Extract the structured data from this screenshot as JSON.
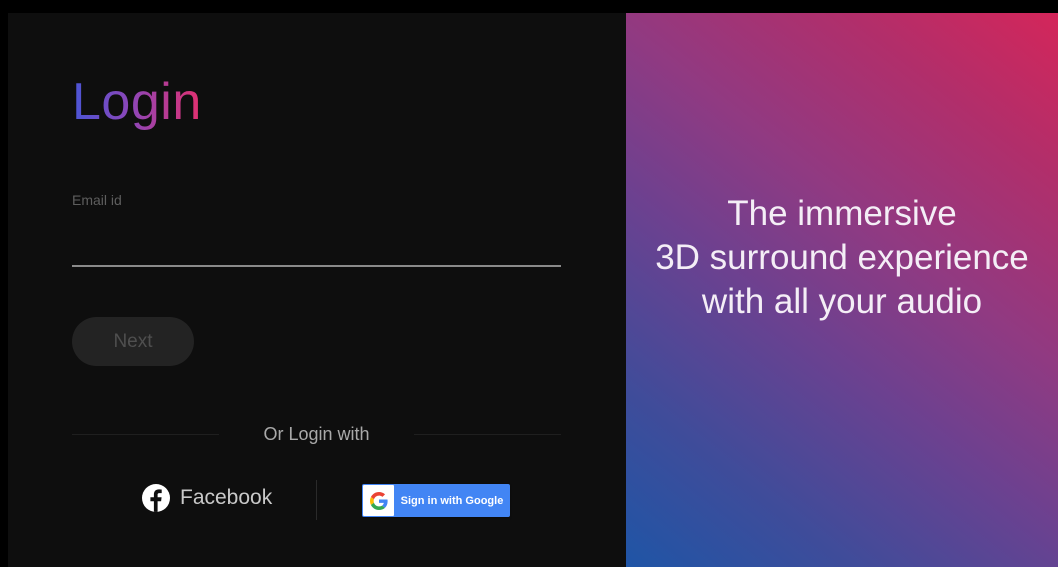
{
  "login": {
    "title": "Login",
    "email_label": "Email id",
    "email_value": "",
    "next_label": "Next",
    "or_text": "Or Login with",
    "facebook_label": "Facebook",
    "google_label": "Sign in with Google"
  },
  "hero": {
    "lines": [
      "The immersive",
      "3D surround experience",
      "with all your audio"
    ]
  },
  "colors": {
    "facebook_icon": "#ffffff",
    "google_button": "#4285f4",
    "title_gradient_start": "#4a55d6",
    "title_gradient_end": "#e2306f",
    "hero_gradient_start": "#1f55a6",
    "hero_gradient_end": "#d4265a"
  },
  "icons": {
    "facebook": "facebook-icon",
    "google": "google-icon"
  }
}
